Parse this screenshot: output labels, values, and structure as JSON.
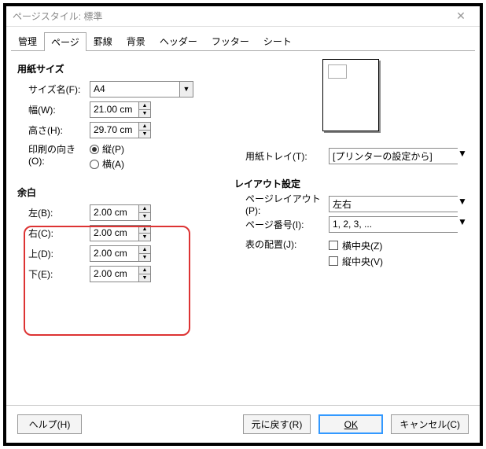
{
  "title": "ページスタイル: 標準",
  "tabs": [
    "管理",
    "ページ",
    "罫線",
    "背景",
    "ヘッダー",
    "フッター",
    "シート"
  ],
  "activeTab": 1,
  "paper": {
    "section": "用紙サイズ",
    "sizeLabel": "サイズ名(F):",
    "sizeValue": "A4",
    "widthLabel": "幅(W):",
    "widthValue": "21.00 cm",
    "heightLabel": "高さ(H):",
    "heightValue": "29.70 cm",
    "orientLabel": "印刷の向き(O):",
    "orientPortrait": "縦(P)",
    "orientLandscape": "横(A)"
  },
  "tray": {
    "label": "用紙トレイ(T):",
    "value": "[プリンターの設定から]"
  },
  "margins": {
    "section": "余白",
    "leftLabel": "左(B):",
    "leftValue": "2.00 cm",
    "rightLabel": "右(C):",
    "rightValue": "2.00 cm",
    "topLabel": "上(D):",
    "topValue": "2.00 cm",
    "bottomLabel": "下(E):",
    "bottomValue": "2.00 cm"
  },
  "layout": {
    "section": "レイアウト設定",
    "pageLayoutLabel": "ページレイアウト(P):",
    "pageLayoutValue": "左右",
    "pageNumLabel": "ページ番号(I):",
    "pageNumValue": "1, 2, 3, ...",
    "tableAlignLabel": "表の配置(J):",
    "horizCenter": "横中央(Z)",
    "vertCenter": "縦中央(V)"
  },
  "buttons": {
    "help": "ヘルプ(H)",
    "reset": "元に戻す(R)",
    "ok": "OK",
    "cancel": "キャンセル(C)"
  }
}
